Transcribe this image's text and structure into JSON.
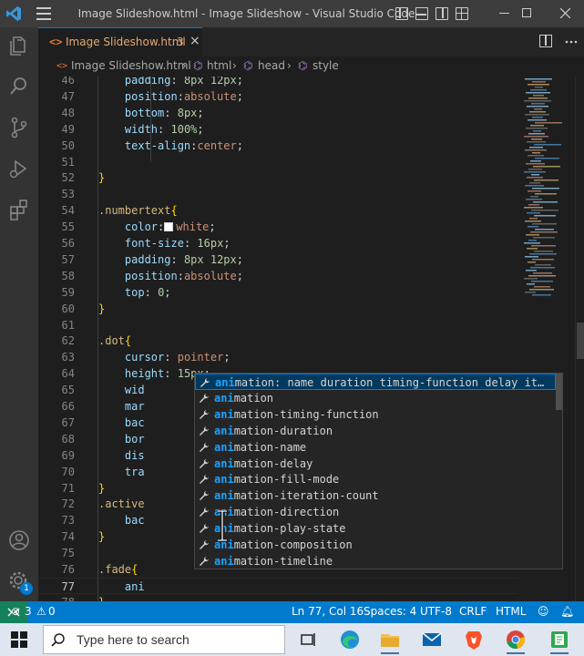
{
  "window": {
    "title": "Image Slideshow.html - Image Slideshow - Visual Studio Code"
  },
  "tab": {
    "label": "Image Slideshow.html",
    "problems_badge": "3",
    "close_glyph": "×"
  },
  "breadcrumb": {
    "file": "Image Slideshow.html",
    "items": [
      "html",
      "head",
      "style"
    ],
    "separator": "›"
  },
  "editor": {
    "lines": [
      {
        "n": "46",
        "text": "    padding: 8px 12px;"
      },
      {
        "n": "47",
        "text": "    position:absolute;"
      },
      {
        "n": "48",
        "text": "    bottom: 8px;"
      },
      {
        "n": "49",
        "text": "    width: 100%;"
      },
      {
        "n": "50",
        "text": "    text-align:center;"
      },
      {
        "n": "51",
        "text": ""
      },
      {
        "n": "52",
        "text": "}"
      },
      {
        "n": "53",
        "text": ""
      },
      {
        "n": "54",
        "text": ".numbertext{"
      },
      {
        "n": "55",
        "text": "    color:white;"
      },
      {
        "n": "56",
        "text": "    font-size: 16px;"
      },
      {
        "n": "57",
        "text": "    padding: 8px 12px;"
      },
      {
        "n": "58",
        "text": "    position:absolute;"
      },
      {
        "n": "59",
        "text": "    top: 0;"
      },
      {
        "n": "60",
        "text": "}"
      },
      {
        "n": "61",
        "text": ""
      },
      {
        "n": "62",
        "text": ".dot{"
      },
      {
        "n": "63",
        "text": "    cursor: pointer;"
      },
      {
        "n": "64",
        "text": "    height: 15px;"
      },
      {
        "n": "65",
        "text": "    wid"
      },
      {
        "n": "66",
        "text": "    mar"
      },
      {
        "n": "67",
        "text": "    bac"
      },
      {
        "n": "68",
        "text": "    bor"
      },
      {
        "n": "69",
        "text": "    dis"
      },
      {
        "n": "70",
        "text": "    tra"
      },
      {
        "n": "71",
        "text": "}"
      },
      {
        "n": "72",
        "text": ".active"
      },
      {
        "n": "73",
        "text": "    bac"
      },
      {
        "n": "74",
        "text": "}"
      },
      {
        "n": "75",
        "text": ""
      },
      {
        "n": "76",
        "text": ".fade{"
      },
      {
        "n": "77",
        "text": "    ani"
      },
      {
        "n": "78",
        "text": "}"
      }
    ],
    "current_line": "77"
  },
  "suggestions": {
    "typed": "ani",
    "items": [
      {
        "match": "ani",
        "rest": "mation: name duration timing-function delay it…"
      },
      {
        "match": "ani",
        "rest": "mation"
      },
      {
        "match": "ani",
        "rest": "mation-timing-function"
      },
      {
        "match": "ani",
        "rest": "mation-duration"
      },
      {
        "match": "ani",
        "rest": "mation-name"
      },
      {
        "match": "ani",
        "rest": "mation-delay"
      },
      {
        "match": "ani",
        "rest": "mation-fill-mode"
      },
      {
        "match": "ani",
        "rest": "mation-iteration-count"
      },
      {
        "match": "ani",
        "rest": "mation-direction"
      },
      {
        "match": "ani",
        "rest": "mation-play-state"
      },
      {
        "match": "ani",
        "rest": "mation-composition"
      },
      {
        "match": "ani",
        "rest": "mation-timeline"
      }
    ]
  },
  "status": {
    "errors": "3",
    "warnings": "0",
    "position": "Ln 77, Col 16",
    "spaces": "Spaces: 4",
    "encoding": "UTF-8",
    "eol": "CRLF",
    "language": "HTML",
    "accounts_badge": "1"
  },
  "taskbar": {
    "search_placeholder": "Type here to search",
    "apps": [
      "task-view",
      "edge",
      "file-explorer",
      "mail",
      "brave",
      "chrome",
      "notepad"
    ]
  },
  "colors": {
    "accent": "#007acc",
    "selector": "#d7ba7d",
    "property": "#9cdcfe",
    "value": "#ce9178",
    "match_highlight": "#18a3ff"
  }
}
